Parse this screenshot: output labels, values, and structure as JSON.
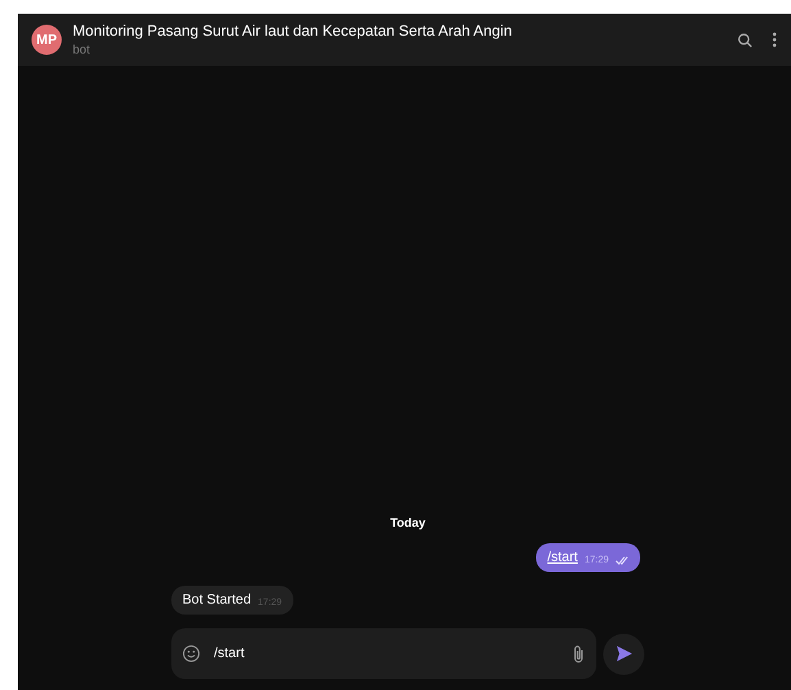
{
  "header": {
    "avatar": "MP",
    "title": "Monitoring Pasang Surut Air laut dan Kecepatan Serta Arah Angin",
    "subtitle": "bot"
  },
  "date_divider": "Today",
  "messages": [
    {
      "text": "/start",
      "time": "17:29",
      "outgoing": true,
      "read": true,
      "link": true
    },
    {
      "text": "Bot Started",
      "time": "17:29",
      "outgoing": false,
      "read": false,
      "link": false
    }
  ],
  "composer": {
    "value": "/start"
  }
}
